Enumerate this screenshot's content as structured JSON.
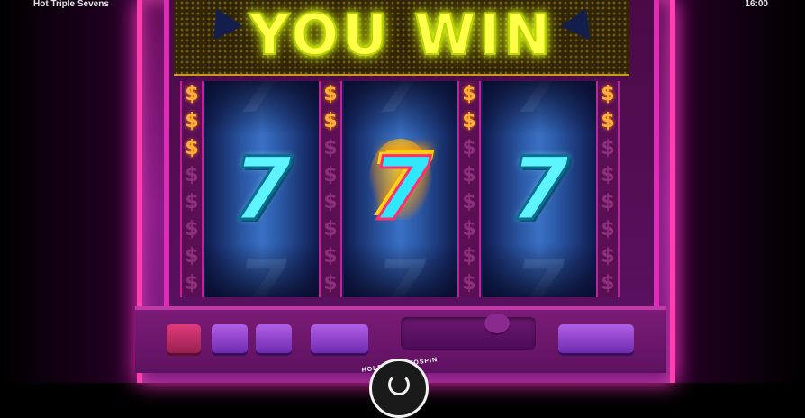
{
  "header": {
    "title": "Hot Triple Sevens",
    "time": "16:00"
  },
  "marquee": {
    "text": "YOU WIN"
  },
  "reels": [
    {
      "symbol": "7",
      "style": "cyan-seven"
    },
    {
      "symbol": "7",
      "style": "hot-flaming-seven"
    },
    {
      "symbol": "7",
      "style": "cyan-seven"
    }
  ],
  "divider_symbol": "$",
  "spin_button": {
    "label": "HOLD TO AUTOSPIN"
  },
  "colors": {
    "marquee_text": "#ffff4a",
    "cabinet_neon": "#ff3fb0",
    "seven_cyan": "#5ef4ff",
    "flame": "#ffb400"
  }
}
